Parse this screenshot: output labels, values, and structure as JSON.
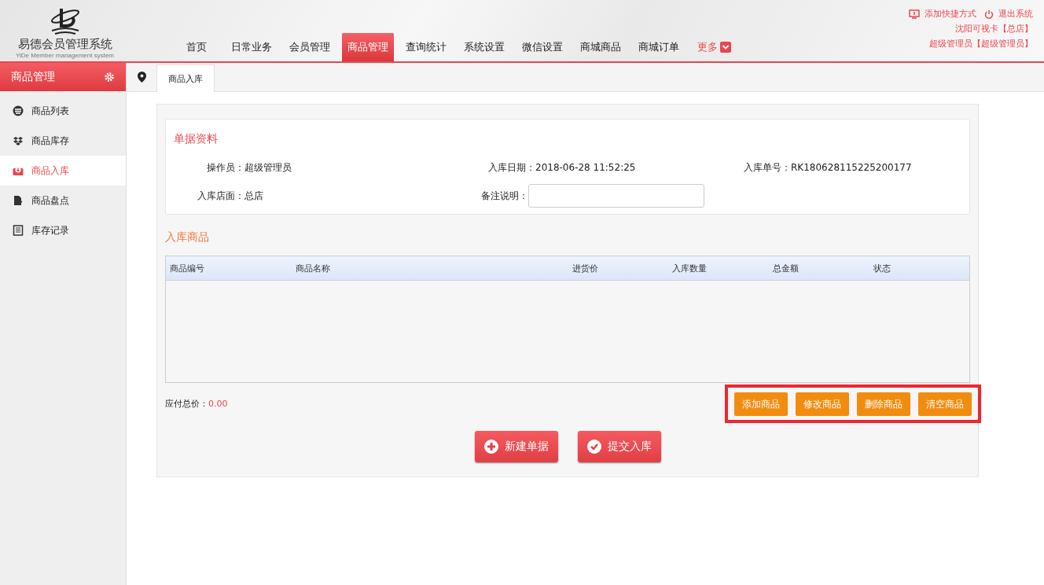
{
  "logo": {
    "title": "易德会员管理系统",
    "subtitle": "YiDe Member management system"
  },
  "nav": [
    {
      "label": "首页",
      "selected": false
    },
    {
      "label": "日常业务",
      "selected": false
    },
    {
      "label": "会员管理",
      "selected": false
    },
    {
      "label": "商品管理",
      "selected": true
    },
    {
      "label": "查询统计",
      "selected": false
    },
    {
      "label": "系统设置",
      "selected": false
    },
    {
      "label": "微信设置",
      "selected": false
    },
    {
      "label": "商城商品",
      "selected": false
    },
    {
      "label": "商城订单",
      "selected": false
    }
  ],
  "more": "更多",
  "top_links": [
    {
      "kind": "shortcut",
      "label": "添加快捷方式"
    },
    {
      "kind": "logout",
      "label": "退出系统"
    }
  ],
  "store_line": "沈阳可视卡【总店】",
  "user_line": "超级管理员【超级管理员】",
  "sidebar": {
    "title": "商品管理",
    "items": [
      {
        "kind": "list",
        "label": "商品列表",
        "selected": false
      },
      {
        "kind": "stock",
        "label": "商品库存",
        "selected": false
      },
      {
        "kind": "inbox",
        "label": "商品入库",
        "selected": true
      },
      {
        "kind": "check",
        "label": "商品盘点",
        "selected": false
      },
      {
        "kind": "record",
        "label": "库存记录",
        "selected": false
      }
    ]
  },
  "tabs": [
    {
      "label": "商品入库",
      "selected": true
    }
  ],
  "bill": {
    "title": "单据资料",
    "operator": {
      "label": "操作员：",
      "value": "超级管理员"
    },
    "date": {
      "label": "入库日期：",
      "value": "2018-06-28 11:52:25"
    },
    "number": {
      "label": "入库单号：",
      "value": "RK180628115225200177"
    },
    "store": {
      "label": "入库店面：",
      "value": "总店"
    },
    "remark": {
      "label": "备注说明："
    }
  },
  "goods": {
    "title": "入库商品",
    "columns": [
      "商品编号",
      "商品名称",
      "进货价",
      "入库数量",
      "总金额",
      "状态"
    ]
  },
  "total": {
    "label": "应付总价：",
    "value": "0.00"
  },
  "actions": [
    "添加商品",
    "修改商品",
    "删除商品",
    "清空商品"
  ],
  "main_buttons": [
    {
      "kind": "plus",
      "label": "新建单据"
    },
    {
      "kind": "check",
      "label": "提交入库"
    }
  ]
}
